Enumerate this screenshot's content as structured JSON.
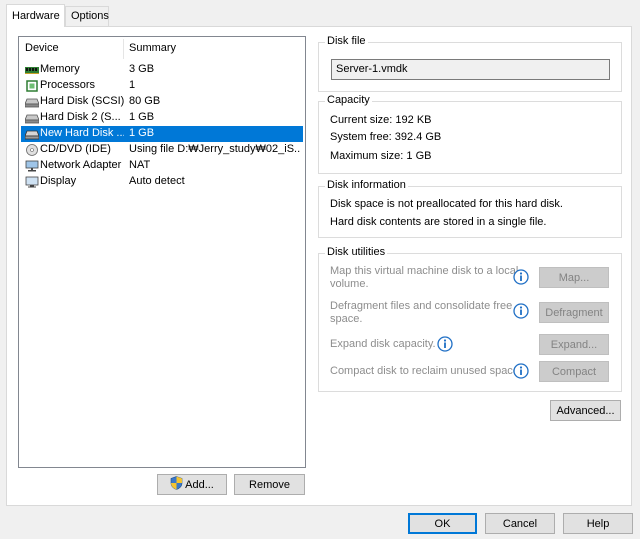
{
  "tabs": [
    {
      "label": "Hardware",
      "active": true
    },
    {
      "label": "Options",
      "active": false
    }
  ],
  "device_list": {
    "headers": {
      "device": "Device",
      "summary": "Summary"
    },
    "rows": [
      {
        "name": "Memory",
        "summary": "3 GB",
        "icon": "memory-icon",
        "selected": false
      },
      {
        "name": "Processors",
        "summary": "1",
        "icon": "processor-icon",
        "selected": false
      },
      {
        "name": "Hard Disk (SCSI)",
        "summary": "80 GB",
        "icon": "hard-disk-icon",
        "selected": false
      },
      {
        "name": "Hard Disk 2 (S...",
        "summary": "1 GB",
        "icon": "hard-disk-icon",
        "selected": false
      },
      {
        "name": "New Hard Disk ...",
        "summary": "1 GB",
        "icon": "hard-disk-icon",
        "selected": true
      },
      {
        "name": "CD/DVD (IDE)",
        "summary": "Using file D:₩Jerry_study₩02_iS...",
        "icon": "cd-dvd-icon",
        "selected": false
      },
      {
        "name": "Network Adapter",
        "summary": "NAT",
        "icon": "network-adapter-icon",
        "selected": false
      },
      {
        "name": "Display",
        "summary": "Auto detect",
        "icon": "display-icon",
        "selected": false
      }
    ]
  },
  "buttons": {
    "add": "Add...",
    "remove": "Remove",
    "ok": "OK",
    "cancel": "Cancel",
    "help": "Help",
    "advanced": "Advanced..."
  },
  "disk_file": {
    "title": "Disk file",
    "value": "Server-1.vmdk"
  },
  "capacity": {
    "title": "Capacity",
    "current_size": "Current size:  192 KB",
    "system_free": "System free:  392.4 GB",
    "maximum_size": "Maximum size:  1 GB"
  },
  "disk_information": {
    "title": "Disk information",
    "line1": "Disk space is not preallocated for this hard disk.",
    "line2": "Hard disk contents are stored in a single file."
  },
  "disk_utilities": {
    "title": "Disk utilities",
    "map_text_1": "Map this virtual machine disk to a local",
    "map_text_2": "volume.",
    "map_button": "Map...",
    "defrag_text_1": "Defragment files and consolidate free",
    "defrag_text_2": "space.",
    "defrag_button": "Defragment",
    "expand_text": "Expand disk capacity.",
    "expand_button": "Expand...",
    "compact_text": "Compact disk to reclaim unused space.",
    "compact_button": "Compact"
  },
  "colors": {
    "selection": "#0078d7",
    "info_icon": "#1f6fc5"
  }
}
